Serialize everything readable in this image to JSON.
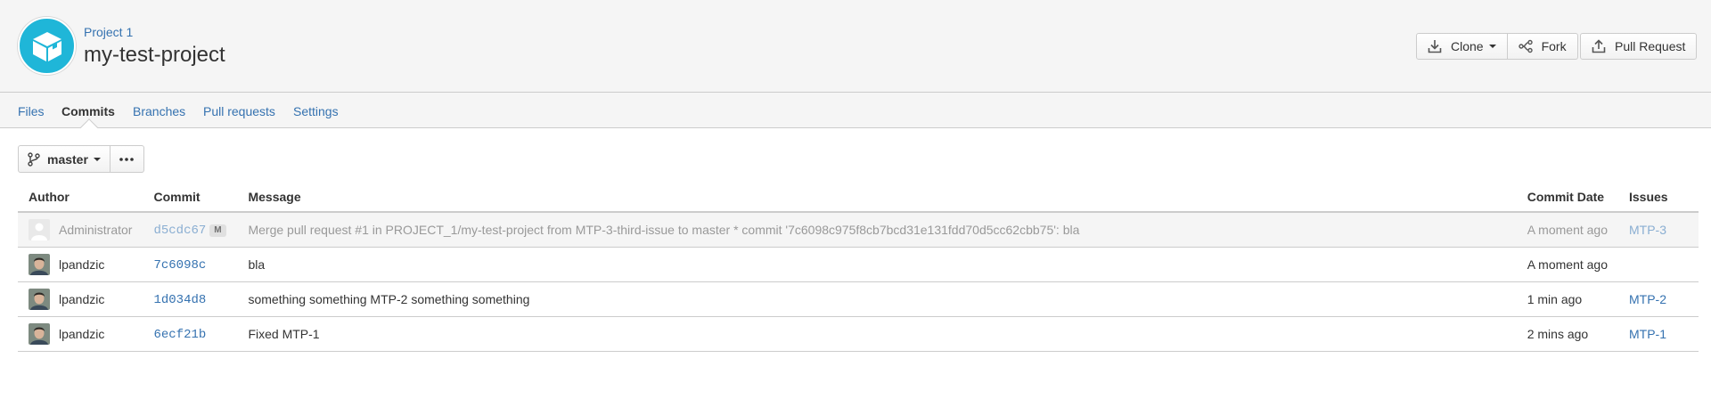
{
  "header": {
    "project_name": "Project 1",
    "repo_name": "my-test-project",
    "project_avatar_icon": "box-icon",
    "accent_color": "#1fb6d8",
    "actions": {
      "clone_label": "Clone",
      "fork_label": "Fork",
      "pull_request_label": "Pull Request"
    }
  },
  "tabs": [
    {
      "label": "Files",
      "active": false
    },
    {
      "label": "Commits",
      "active": true
    },
    {
      "label": "Branches",
      "active": false
    },
    {
      "label": "Pull requests",
      "active": false
    },
    {
      "label": "Settings",
      "active": false
    }
  ],
  "branch": {
    "name": "master",
    "more_label": "•••"
  },
  "table": {
    "columns": {
      "author": "Author",
      "commit": "Commit",
      "message": "Message",
      "date": "Commit Date",
      "issues": "Issues"
    },
    "rows": [
      {
        "author": "Administrator",
        "commit": "d5cdc67",
        "badge": "M",
        "message": "Merge pull request #1 in PROJECT_1/my-test-project from MTP-3-third-issue to master * commit '7c6098c975f8cb7bcd31e131fdd70d5cc62cbb75': bla",
        "date": "A moment ago",
        "issue": "MTP-3",
        "is_merge": true
      },
      {
        "author": "lpandzic",
        "commit": "7c6098c",
        "message": "bla",
        "date": "A moment ago",
        "issue": ""
      },
      {
        "author": "lpandzic",
        "commit": "1d034d8",
        "message": "something something MTP-2 something something",
        "date": "1 min ago",
        "issue": "MTP-2"
      },
      {
        "author": "lpandzic",
        "commit": "6ecf21b",
        "message": "Fixed MTP-1",
        "date": "2 mins ago",
        "issue": "MTP-1"
      }
    ]
  }
}
